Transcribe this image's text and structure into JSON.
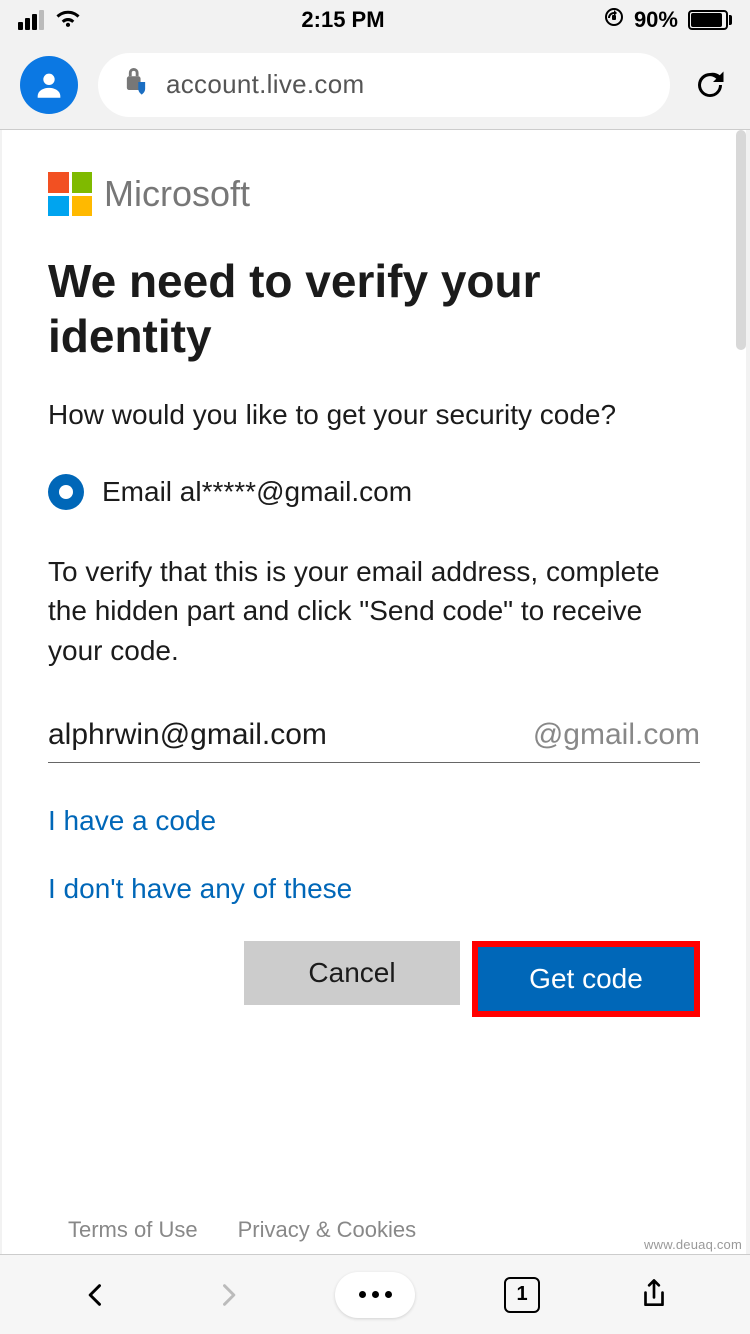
{
  "status_bar": {
    "time": "2:15 PM",
    "battery_percent": "90%"
  },
  "browser": {
    "url": "account.live.com"
  },
  "brand": {
    "name": "Microsoft"
  },
  "page": {
    "title": "We need to verify your identity",
    "subtitle": "How would you like to get your security code?",
    "radio_email_label": "Email al*****@gmail.com",
    "instruction": "To verify that this is your email address, complete the hidden part and click \"Send code\" to receive your code.",
    "email_value": "alphrwin@gmail.com",
    "email_suffix": "@gmail.com",
    "link_have_code": "I have a code",
    "link_none": "I don't have any of these",
    "cancel_label": "Cancel",
    "submit_label": "Get code"
  },
  "footer": {
    "terms": "Terms of Use",
    "privacy": "Privacy & Cookies"
  },
  "watermark": "www.deuaq.com",
  "bottom_toolbar": {
    "tab_count": "1"
  }
}
